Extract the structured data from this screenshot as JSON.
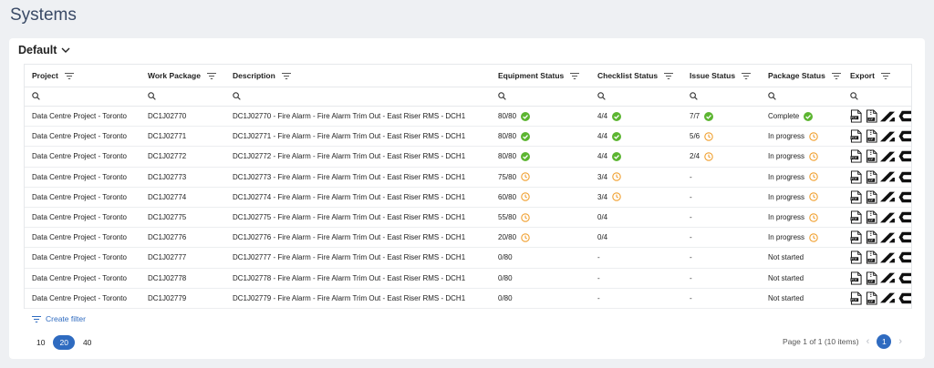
{
  "page": {
    "title": "Systems"
  },
  "view": {
    "label": "Default"
  },
  "columns": [
    "Project",
    "Work Package",
    "Description",
    "Equipment Status",
    "Checklist Status",
    "Issue Status",
    "Package Status",
    "Export"
  ],
  "rows": [
    {
      "project": "Data Centre Project - Toronto",
      "wp": "DC1J02770",
      "desc": "DC1J02770 - Fire Alarm - Fire Alarm Trim Out - East Riser RMS - DCH1",
      "equip": "80/80",
      "equip_state": "ok",
      "check": "4/4",
      "check_state": "ok",
      "issue": "7/7",
      "issue_state": "ok",
      "pkg": "Complete",
      "pkg_state": "ok"
    },
    {
      "project": "Data Centre Project - Toronto",
      "wp": "DC1J02771",
      "desc": "DC1J02771 - Fire Alarm - Fire Alarm Trim Out - East Riser RMS - DCH1",
      "equip": "80/80",
      "equip_state": "ok",
      "check": "4/4",
      "check_state": "ok",
      "issue": "5/6",
      "issue_state": "pending",
      "pkg": "In progress",
      "pkg_state": "pending"
    },
    {
      "project": "Data Centre Project - Toronto",
      "wp": "DC1J02772",
      "desc": "DC1J02772 - Fire Alarm - Fire Alarm Trim Out - East Riser RMS - DCH1",
      "equip": "80/80",
      "equip_state": "ok",
      "check": "4/4",
      "check_state": "ok",
      "issue": "2/4",
      "issue_state": "pending",
      "pkg": "In progress",
      "pkg_state": "pending"
    },
    {
      "project": "Data Centre Project - Toronto",
      "wp": "DC1J02773",
      "desc": "DC1J02773 - Fire Alarm - Fire Alarm Trim Out - East Riser RMS - DCH1",
      "equip": "75/80",
      "equip_state": "pending",
      "check": "3/4",
      "check_state": "pending",
      "issue": "-",
      "issue_state": "none",
      "pkg": "In progress",
      "pkg_state": "pending"
    },
    {
      "project": "Data Centre Project - Toronto",
      "wp": "DC1J02774",
      "desc": "DC1J02774 - Fire Alarm - Fire Alarm Trim Out - East Riser RMS - DCH1",
      "equip": "60/80",
      "equip_state": "pending",
      "check": "3/4",
      "check_state": "pending",
      "issue": "-",
      "issue_state": "none",
      "pkg": "In progress",
      "pkg_state": "pending"
    },
    {
      "project": "Data Centre Project - Toronto",
      "wp": "DC1J02775",
      "desc": "DC1J02775 - Fire Alarm - Fire Alarm Trim Out - East Riser RMS - DCH1",
      "equip": "55/80",
      "equip_state": "pending",
      "check": "0/4",
      "check_state": "none",
      "issue": "-",
      "issue_state": "none",
      "pkg": "In progress",
      "pkg_state": "pending"
    },
    {
      "project": "Data Centre Project - Toronto",
      "wp": "DC1J02776",
      "desc": "DC1J02776 - Fire Alarm - Fire Alarm Trim Out - East Riser RMS - DCH1",
      "equip": "20/80",
      "equip_state": "pending",
      "check": "0/4",
      "check_state": "none",
      "issue": "-",
      "issue_state": "none",
      "pkg": "In progress",
      "pkg_state": "pending"
    },
    {
      "project": "Data Centre Project - Toronto",
      "wp": "DC1J02777",
      "desc": "DC1J02777 - Fire Alarm - Fire Alarm Trim Out - East Riser RMS - DCH1",
      "equip": "0/80",
      "equip_state": "none",
      "check": "-",
      "check_state": "none",
      "issue": "-",
      "issue_state": "none",
      "pkg": "Not started",
      "pkg_state": "none"
    },
    {
      "project": "Data Centre Project - Toronto",
      "wp": "DC1J02778",
      "desc": "DC1J02778 - Fire Alarm - Fire Alarm Trim Out - East Riser RMS - DCH1",
      "equip": "0/80",
      "equip_state": "none",
      "check": "-",
      "check_state": "none",
      "issue": "-",
      "issue_state": "none",
      "pkg": "Not started",
      "pkg_state": "none"
    },
    {
      "project": "Data Centre Project - Toronto",
      "wp": "DC1J02779",
      "desc": "DC1J02779 - Fire Alarm - Fire Alarm Trim Out - East Riser RMS - DCH1",
      "equip": "0/80",
      "equip_state": "none",
      "check": "-",
      "check_state": "none",
      "issue": "-",
      "issue_state": "none",
      "pkg": "Not started",
      "pkg_state": "none"
    }
  ],
  "export_icons": [
    "pdf-file-icon",
    "zip-file-icon",
    "autodesk-logo-icon",
    "procore-logo-icon"
  ],
  "filter": {
    "label": "Create filter"
  },
  "pager": {
    "sizes": [
      "10",
      "20",
      "40"
    ],
    "active_size": "20",
    "info": "Page 1 of 1 (10 items)",
    "current": "1"
  },
  "colors": {
    "ok": "#5cb531",
    "pending": "#f0a030",
    "accent": "#2f6bc0"
  }
}
